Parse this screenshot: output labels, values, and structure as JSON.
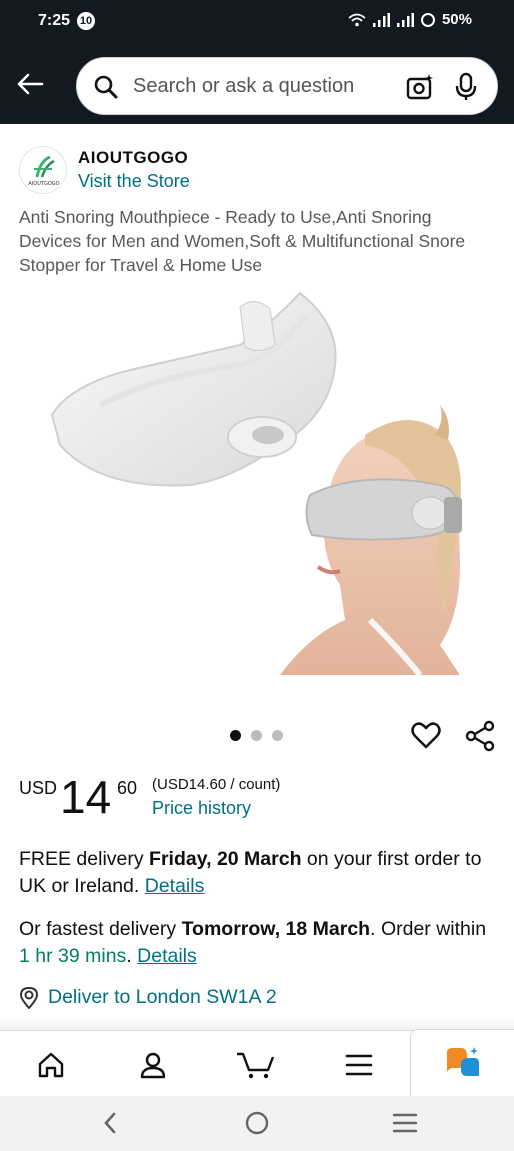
{
  "status_bar": {
    "time": "7:25",
    "notification_count": "10",
    "battery": "50%"
  },
  "header": {
    "search_placeholder": "Search or ask a question",
    "icons": [
      "back-arrow-icon",
      "search-icon",
      "camera-icon",
      "microphone-icon"
    ]
  },
  "brand": {
    "name": "AIOUTGOGO",
    "store_link": "Visit the Store",
    "logo_text": "AIOUTGOGO"
  },
  "product": {
    "title": "Anti Snoring Mouthpiece - Ready to Use,Anti Snoring Devices for Men and Women,Soft & Multifunctional Snore Stopper for Travel & Home Use",
    "image_count": 3,
    "active_image": 1
  },
  "price": {
    "currency": "USD",
    "whole": "14",
    "fraction": "60",
    "unit_price": "(USD14.60 / count)",
    "history_link": "Price history"
  },
  "delivery": {
    "free_prefix": "FREE delivery ",
    "free_date": "Friday, 20 March",
    "free_suffix": " on your first order to UK or Ireland. ",
    "free_details": "Details",
    "fast_prefix": "Or fastest delivery ",
    "fast_date": "Tomorrow, 18 March",
    "fast_mid": ". Order within ",
    "fast_time": "1 hr 39 mins",
    "fast_dot": ". ",
    "fast_details": "Details",
    "deliver_to": "Deliver to London SW1A 2"
  },
  "bottom_nav": [
    "home-icon",
    "account-icon",
    "cart-icon",
    "menu-icon",
    "rufus-icon"
  ],
  "colors": {
    "header_bg": "#131921",
    "link": "#007185",
    "green": "#067d62",
    "text": "#0f1111",
    "muted": "#565959"
  }
}
